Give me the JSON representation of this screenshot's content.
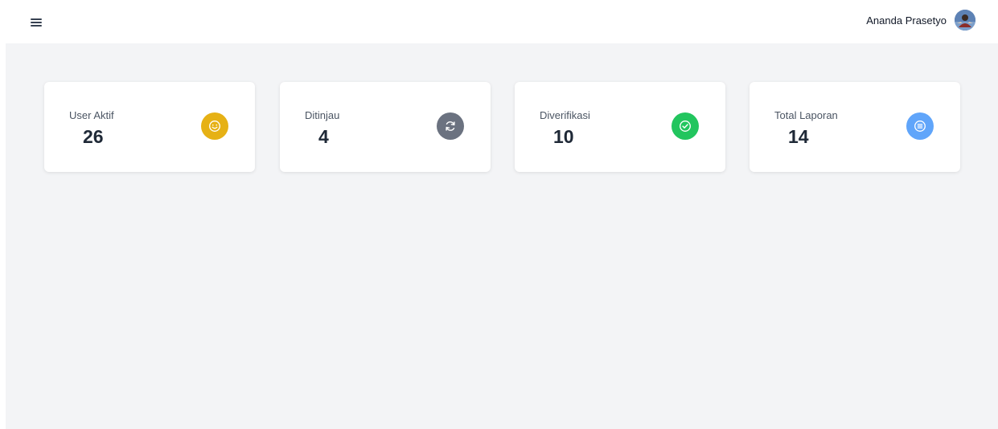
{
  "header": {
    "menu_icon": "hamburger-menu-icon",
    "user_name": "Ananda Prasetyo",
    "avatar_icon": "user-avatar"
  },
  "stats": [
    {
      "label": "User Aktif",
      "value": "26",
      "icon": "smile-icon",
      "color": "#e6b115"
    },
    {
      "label": "Ditinjau",
      "value": "4",
      "icon": "refresh-icon",
      "color": "#6b7280"
    },
    {
      "label": "Diverifikasi",
      "value": "10",
      "icon": "check-circle-icon",
      "color": "#22c55e"
    },
    {
      "label": "Total Laporan",
      "value": "14",
      "icon": "list-icon",
      "color": "#60a5fa"
    }
  ]
}
